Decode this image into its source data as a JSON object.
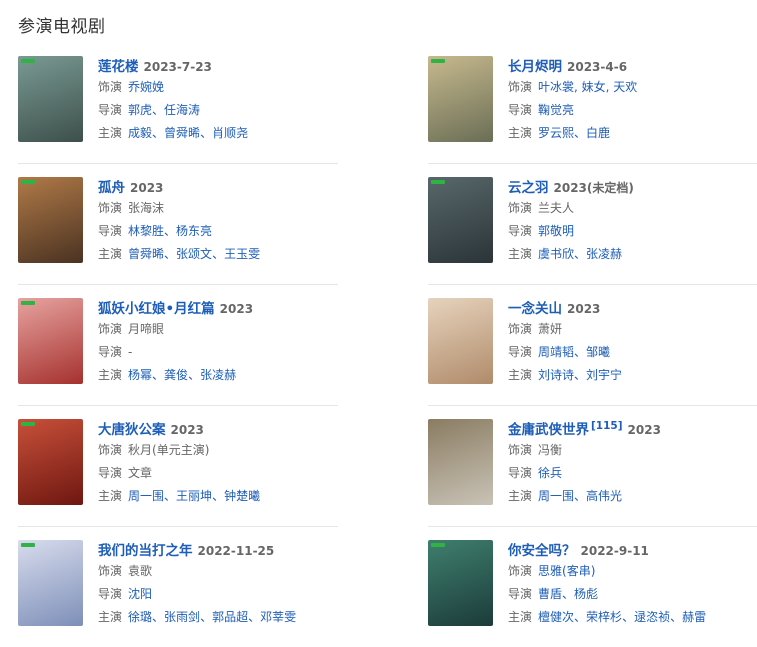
{
  "section_title": "参演电视剧",
  "labels": {
    "role": "饰演",
    "director": "导演",
    "starring": "主演"
  },
  "items": [
    {
      "title": "莲花楼",
      "sup": "",
      "year": "2023-7-23",
      "role": "乔婉娩",
      "role_is_link": true,
      "directors": [
        "郭虎",
        "任海涛"
      ],
      "director_sep": "、",
      "stars": [
        "成毅",
        "曾舜晞",
        "肖顺尧"
      ],
      "star_sep": "、",
      "poster_text": "莲花楼",
      "poster_colors": [
        "#3d4f4b",
        "#7a9a93"
      ],
      "tag": true
    },
    {
      "title": "长月烬明",
      "sup": "",
      "year": "2023-4-6",
      "role": "叶冰裳, 妹女, 天欢",
      "role_is_link": true,
      "directors": [
        "鞠觉亮"
      ],
      "director_sep": "、",
      "stars": [
        "罗云熙",
        "白鹿"
      ],
      "star_sep": "、",
      "poster_text": "",
      "poster_colors": [
        "#6a6e55",
        "#c7b98e"
      ],
      "tag": true
    },
    {
      "title": "孤舟",
      "sup": "",
      "year": "2023",
      "role": "张海沫",
      "role_is_link": false,
      "directors": [
        "林黎胜",
        "杨东亮"
      ],
      "director_sep": "、",
      "stars": [
        "曾舜晞",
        "张颂文",
        "王玉雯"
      ],
      "star_sep": "、",
      "poster_text": "孤舟",
      "poster_colors": [
        "#4a3222",
        "#b07a47"
      ],
      "tag": true
    },
    {
      "title": "云之羽",
      "sup": "",
      "year": "2023(未定档)",
      "role": "兰夫人",
      "role_is_link": false,
      "directors": [
        "郭敬明"
      ],
      "director_sep": "、",
      "stars": [
        "虞书欣",
        "张凌赫"
      ],
      "star_sep": "、",
      "poster_text": "",
      "poster_colors": [
        "#2b3438",
        "#58686a"
      ],
      "tag": true
    },
    {
      "title": "狐妖小红娘•月红篇",
      "sup": "",
      "year": "2023",
      "role": "月啼眼",
      "role_is_link": false,
      "directors": [
        "-"
      ],
      "director_sep": "、",
      "directors_plain": true,
      "stars": [
        "杨幂",
        "龚俊",
        "张凌赫"
      ],
      "star_sep": "、",
      "poster_text": "",
      "poster_colors": [
        "#a5312e",
        "#e7a3a0"
      ],
      "tag": true
    },
    {
      "title": "一念关山",
      "sup": "",
      "year": "2023",
      "role": "萧妍",
      "role_is_link": false,
      "directors": [
        "周靖韬",
        "邹曦"
      ],
      "director_sep": "、",
      "stars": [
        "刘诗诗",
        "刘宇宁"
      ],
      "star_sep": "、",
      "poster_text": "一念关山",
      "poster_colors": [
        "#b08b6a",
        "#e6d3bd"
      ],
      "tag": false
    },
    {
      "title": "大唐狄公案",
      "sup": "",
      "year": "2023",
      "role": "秋月(单元主演)",
      "role_is_link": false,
      "directors": [
        "文章"
      ],
      "director_sep": "、",
      "directors_plain": true,
      "stars": [
        "周一围",
        "王丽坤",
        "钟楚曦"
      ],
      "star_sep": "、",
      "poster_text": "大唐狄公案",
      "poster_colors": [
        "#6e1710",
        "#c8503a"
      ],
      "tag": true
    },
    {
      "title": "金庸武侠世界",
      "sup": "[115]",
      "year": "2023",
      "role": "冯衡",
      "role_is_link": false,
      "directors": [
        "徐兵"
      ],
      "director_sep": "、",
      "stars": [
        "周一围",
        "高伟光"
      ],
      "star_sep": "、",
      "poster_text": "金庸",
      "poster_colors": [
        "#c9c3b6",
        "#8a7c62"
      ],
      "tag": false
    },
    {
      "title": "我们的当打之年",
      "sup": "",
      "year": "2022-11-25",
      "role": "袁歌",
      "role_is_link": false,
      "directors": [
        "沈阳"
      ],
      "director_sep": "、",
      "stars": [
        "徐璐",
        "张雨剑",
        "郭品超",
        "邓莘雯"
      ],
      "star_sep": "、",
      "poster_text": "",
      "poster_colors": [
        "#7d8fb8",
        "#d8dced"
      ],
      "tag": true
    },
    {
      "title": "你安全吗？",
      "sup": "",
      "year": "2022-9-11",
      "role": "思雅(客串)",
      "role_is_link": true,
      "directors": [
        "曹盾",
        "杨彪"
      ],
      "director_sep": "、",
      "stars": [
        "檀健次",
        "荣梓杉",
        "逯恣祯",
        "赫雷"
      ],
      "star_sep": "、",
      "poster_text": "",
      "poster_colors": [
        "#1c3b3a",
        "#3f7f6e"
      ],
      "tag": true
    }
  ]
}
